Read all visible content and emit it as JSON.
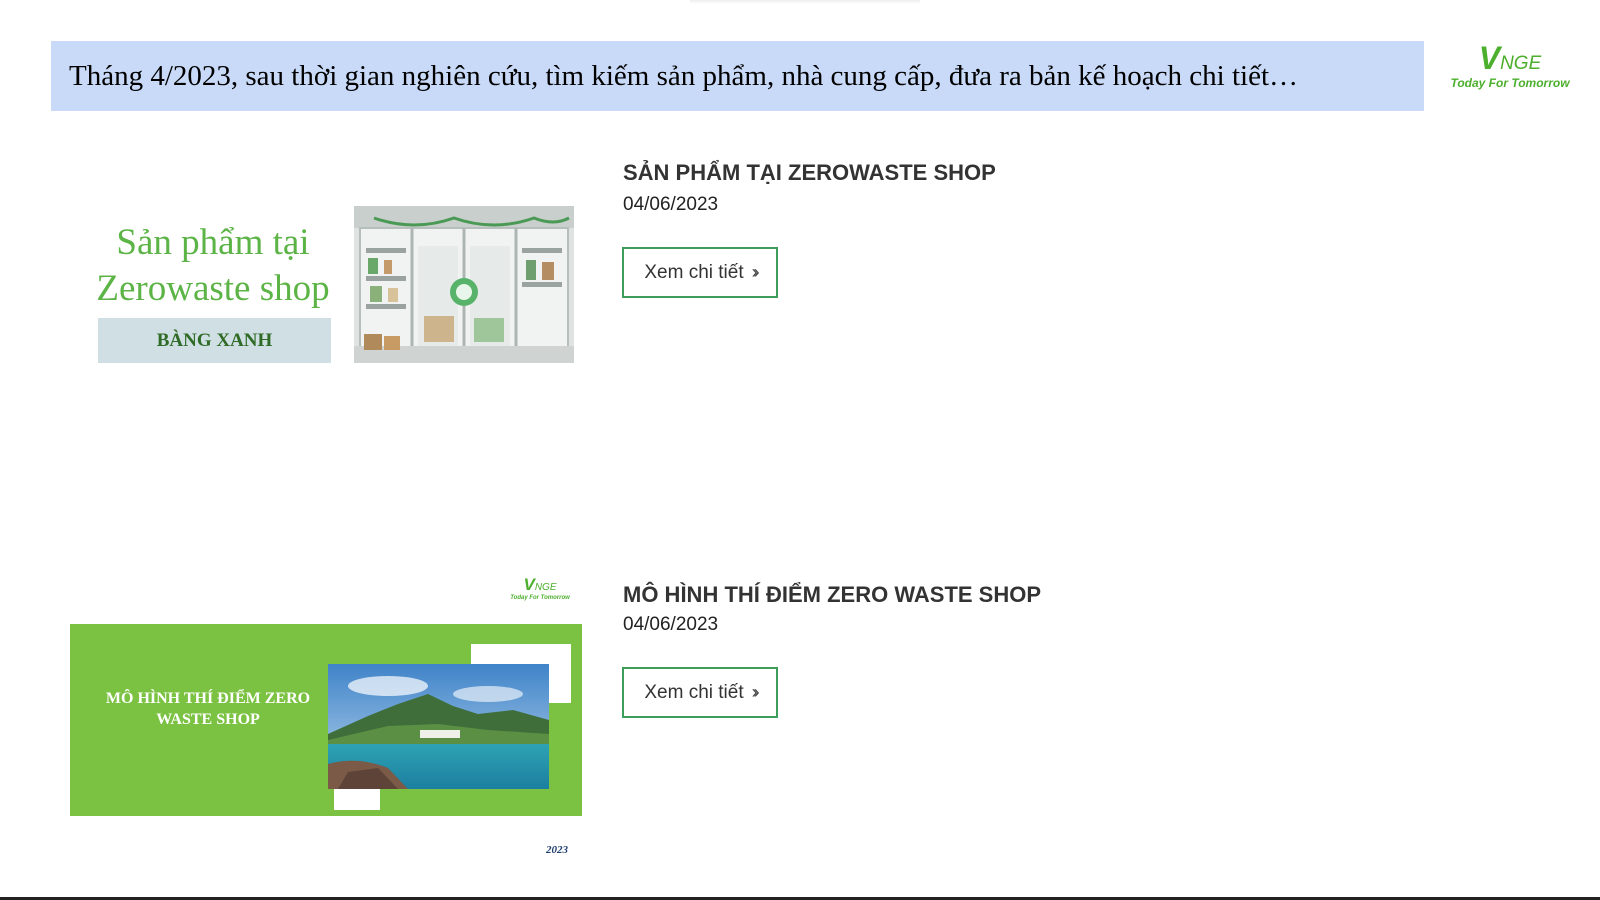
{
  "banner": {
    "text": "Tháng 4/2023, sau thời gian nghiên cứu, tìm kiếm sản phẩm, nhà cung cấp, đưa ra bản kế hoạch chi tiết…"
  },
  "logo": {
    "mark_big": "V",
    "mark_small": "NGE",
    "tagline": "Today For Tomorrow"
  },
  "colors": {
    "banner_bg": "#c9daf8",
    "brand_green": "#4caf2d",
    "button_border": "#3c9e5a",
    "thumb_green": "#7cc242"
  },
  "posts": [
    {
      "title": "SẢN PHẨM TẠI ZEROWASTE SHOP",
      "date": "04/06/2023",
      "button_label": "Xem chi tiết",
      "button_icon": "double-chevron-right-icon",
      "thumb": {
        "title": "Sản phẩm tại Zerowaste shop",
        "badge": "BÀNG XANH"
      }
    },
    {
      "title": "MÔ HÌNH THÍ ĐIỂM ZERO WASTE SHOP",
      "date": "04/06/2023",
      "button_label": "Xem chi tiết",
      "button_icon": "double-chevron-right-icon",
      "thumb": {
        "title": "MÔ HÌNH THÍ ĐIỂM ZERO WASTE SHOP",
        "year": "2023"
      }
    }
  ]
}
